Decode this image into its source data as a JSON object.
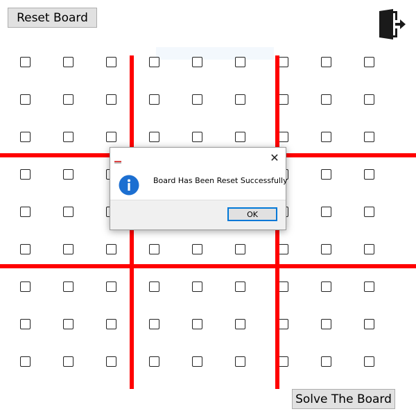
{
  "toolbar": {
    "reset_label": "Reset Board",
    "solve_label": "Solve The Board",
    "exit_icon": "exit-door-icon"
  },
  "board": {
    "rows": 9,
    "cols": 9,
    "cell_states": [
      [
        false,
        false,
        false,
        false,
        false,
        false,
        false,
        false,
        false
      ],
      [
        false,
        false,
        false,
        false,
        false,
        false,
        false,
        false,
        false
      ],
      [
        false,
        false,
        false,
        false,
        false,
        false,
        false,
        false,
        false
      ],
      [
        false,
        false,
        false,
        false,
        false,
        false,
        false,
        false,
        false
      ],
      [
        false,
        false,
        false,
        false,
        false,
        false,
        false,
        false,
        false
      ],
      [
        false,
        false,
        false,
        false,
        false,
        false,
        false,
        false,
        false
      ],
      [
        false,
        false,
        false,
        false,
        false,
        false,
        false,
        false,
        false
      ],
      [
        false,
        false,
        false,
        false,
        false,
        false,
        false,
        false,
        false
      ],
      [
        false,
        false,
        false,
        false,
        false,
        false,
        false,
        false,
        false
      ]
    ],
    "divider_color": "#ff0000"
  },
  "dialog": {
    "message": "Board Has Been Reset Successfully",
    "ok_label": "OK",
    "info_icon": "info-icon",
    "close_icon": "close-icon",
    "accent_color": "#0078d7"
  }
}
